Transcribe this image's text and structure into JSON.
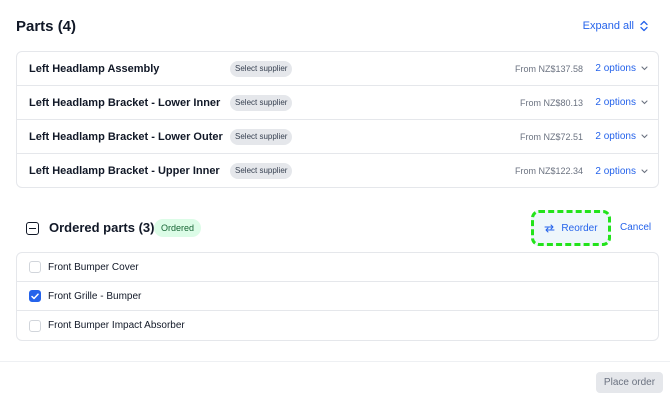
{
  "parts": {
    "title": "Parts (4)",
    "expand_all_label": "Expand all",
    "items": [
      {
        "name": "Left Headlamp Assembly",
        "supplier_label": "Select supplier",
        "price": "From NZ$137.58",
        "options": "2 options"
      },
      {
        "name": "Left Headlamp Bracket - Lower Inner",
        "supplier_label": "Select supplier",
        "price": "From NZ$80.13",
        "options": "2 options"
      },
      {
        "name": "Left Headlamp Bracket - Lower Outer",
        "supplier_label": "Select supplier",
        "price": "From NZ$72.51",
        "options": "2 options"
      },
      {
        "name": "Left Headlamp Bracket - Upper Inner",
        "supplier_label": "Select supplier",
        "price": "From NZ$122.34",
        "options": "2 options"
      }
    ]
  },
  "ordered": {
    "title": "Ordered parts (3)",
    "badge": "Ordered",
    "reorder_label": "Reorder",
    "cancel_label": "Cancel",
    "items": [
      {
        "name": "Front Bumper Cover",
        "checked": false
      },
      {
        "name": "Front Grille - Bumper",
        "checked": true
      },
      {
        "name": "Front Bumper Impact Absorber",
        "checked": false
      }
    ]
  },
  "footer": {
    "place_order_label": "Place order"
  },
  "colors": {
    "accent": "#2563eb",
    "ordered_badge_bg": "#dcfce7",
    "highlight_dash": "#22e31a"
  }
}
